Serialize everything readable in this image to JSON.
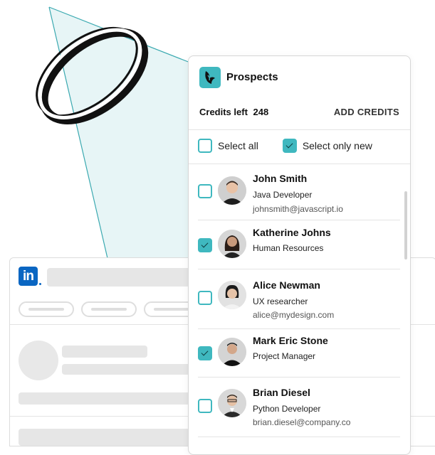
{
  "panel": {
    "title": "Prospects",
    "credits_label": "Credits left",
    "credits_value": "248",
    "add_credits_label": "ADD CREDITS",
    "select_all_label": "Select all",
    "select_only_new_label": "Select only new",
    "select_all_checked": false,
    "select_only_new_checked": true
  },
  "prospects": [
    {
      "name": "John Smith",
      "role": "Java Developer",
      "email": "johnsmith@javascript.io",
      "checked": false
    },
    {
      "name": "Katherine Johns",
      "role": "Human Resources",
      "email": "",
      "checked": true
    },
    {
      "name": "Alice Newman",
      "role": "UX researcher",
      "email": "alice@mydesign.com",
      "checked": false
    },
    {
      "name": "Mark Eric Stone",
      "role": "Project Manager",
      "email": "",
      "checked": true
    },
    {
      "name": "Brian Diesel",
      "role": "Python Developer",
      "email": "brian.diesel@company.co",
      "checked": false
    }
  ],
  "linkedin": {
    "logo_text": "in"
  },
  "colors": {
    "accent": "#3fb8bf",
    "linkedin_blue": "#0a66c2"
  }
}
